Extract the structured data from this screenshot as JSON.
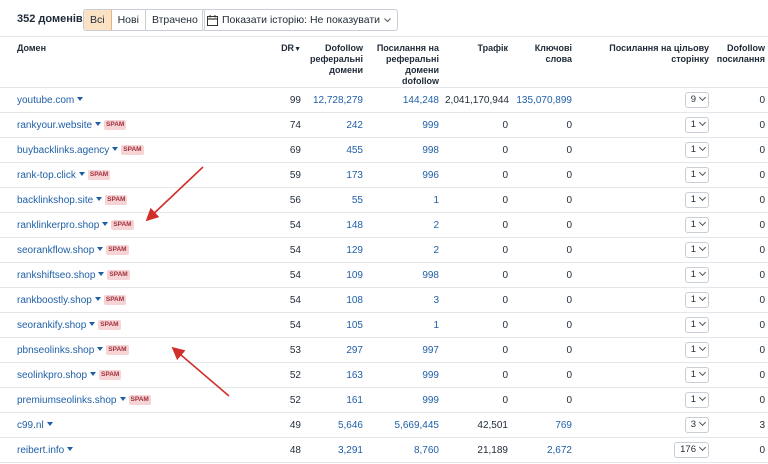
{
  "toolbar": {
    "count_label": "352 доменів",
    "filters": [
      "Всі",
      "Нові",
      "Втрачено"
    ],
    "active_filter": "Всі",
    "history_label": "Показати історію: Не показувати"
  },
  "table": {
    "headers": {
      "domain": "Домен",
      "dr": "DR",
      "dofollow_ref": "Dofollow реферальні домени",
      "links_to_ref": "Посилання на реферальні домени dofollow",
      "traffic": "Трафік",
      "keywords": "Ключові слова",
      "links_to_target": "Посилання на цільову сторінку",
      "dofollow_links": "Dofollow посилання"
    },
    "rows": [
      {
        "domain": "youtube.com",
        "spam": "",
        "dr": "99",
        "dofollow_ref": "12,728,279",
        "links_ref": "144,248",
        "traffic": "2,041,170,944",
        "keywords": "135,070,899",
        "target": "9",
        "dofollow": "0"
      },
      {
        "domain": "rankyour.website",
        "spam": "SPAM",
        "dr": "74",
        "dofollow_ref": "242",
        "links_ref": "999",
        "traffic": "0",
        "keywords": "0",
        "target": "1",
        "dofollow": "0"
      },
      {
        "domain": "buybacklinks.agency",
        "spam": "SPAM",
        "dr": "69",
        "dofollow_ref": "455",
        "links_ref": "998",
        "traffic": "0",
        "keywords": "0",
        "target": "1",
        "dofollow": "0"
      },
      {
        "domain": "rank-top.click",
        "spam": "SPAM",
        "dr": "59",
        "dofollow_ref": "173",
        "links_ref": "996",
        "traffic": "0",
        "keywords": "0",
        "target": "1",
        "dofollow": "0"
      },
      {
        "domain": "backlinkshop.site",
        "spam": "SPAM",
        "dr": "56",
        "dofollow_ref": "55",
        "links_ref": "1",
        "traffic": "0",
        "keywords": "0",
        "target": "1",
        "dofollow": "0"
      },
      {
        "domain": "ranklinkerpro.shop",
        "spam": "SPAM",
        "dr": "54",
        "dofollow_ref": "148",
        "links_ref": "2",
        "traffic": "0",
        "keywords": "0",
        "target": "1",
        "dofollow": "0"
      },
      {
        "domain": "seorankflow.shop",
        "spam": "SPAM",
        "dr": "54",
        "dofollow_ref": "129",
        "links_ref": "2",
        "traffic": "0",
        "keywords": "0",
        "target": "1",
        "dofollow": "0"
      },
      {
        "domain": "rankshiftseo.shop",
        "spam": "SPAM",
        "dr": "54",
        "dofollow_ref": "109",
        "links_ref": "998",
        "traffic": "0",
        "keywords": "0",
        "target": "1",
        "dofollow": "0"
      },
      {
        "domain": "rankboostly.shop",
        "spam": "SPAM",
        "dr": "54",
        "dofollow_ref": "108",
        "links_ref": "3",
        "traffic": "0",
        "keywords": "0",
        "target": "1",
        "dofollow": "0"
      },
      {
        "domain": "seorankify.shop",
        "spam": "SPAM",
        "dr": "54",
        "dofollow_ref": "105",
        "links_ref": "1",
        "traffic": "0",
        "keywords": "0",
        "target": "1",
        "dofollow": "0"
      },
      {
        "domain": "pbnseolinks.shop",
        "spam": "SPAM",
        "dr": "53",
        "dofollow_ref": "297",
        "links_ref": "997",
        "traffic": "0",
        "keywords": "0",
        "target": "1",
        "dofollow": "0"
      },
      {
        "domain": "seolinkpro.shop",
        "spam": "SPAM",
        "dr": "52",
        "dofollow_ref": "163",
        "links_ref": "999",
        "traffic": "0",
        "keywords": "0",
        "target": "1",
        "dofollow": "0"
      },
      {
        "domain": "premiumseolinks.shop",
        "spam": "SPAM",
        "dr": "52",
        "dofollow_ref": "161",
        "links_ref": "999",
        "traffic": "0",
        "keywords": "0",
        "target": "1",
        "dofollow": "0"
      },
      {
        "domain": "c99.nl",
        "spam": "",
        "dr": "49",
        "dofollow_ref": "5,646",
        "links_ref": "5,669,445",
        "traffic": "42,501",
        "keywords": "769",
        "target": "3",
        "dofollow": "3"
      },
      {
        "domain": "reibert.info",
        "spam": "",
        "dr": "48",
        "dofollow_ref": "3,291",
        "links_ref": "8,760",
        "traffic": "21,189",
        "keywords": "2,672",
        "target": "176",
        "dofollow": "0"
      }
    ]
  },
  "colors": {
    "link": "#1f5fa8",
    "spam_bg": "#f6d4d6",
    "spam_text": "#a0303a",
    "active_filter_bg": "#fbe2c5",
    "annotation_arrow": "#d0302a"
  }
}
